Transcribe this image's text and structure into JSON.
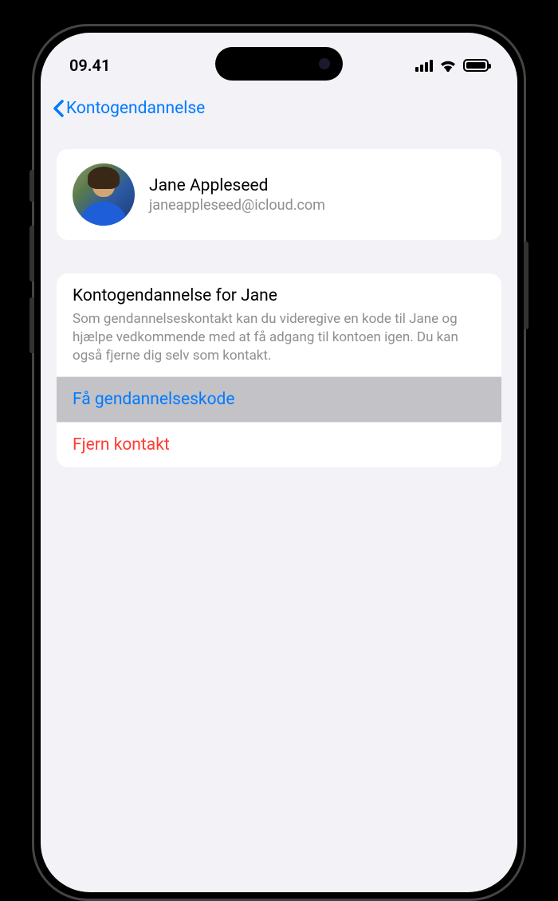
{
  "status": {
    "time": "09.41"
  },
  "nav": {
    "back_label": "Kontogendannelse"
  },
  "contact": {
    "name": "Jane Appleseed",
    "email": "janeappleseed@icloud.com"
  },
  "section": {
    "title": "Kontogendannelse for Jane",
    "description": "Som gendannelseskontakt kan du videregive en kode til Jane og hjælpe vedkommende med at få adgang til kontoen igen. Du kan også fjerne dig selv som kontakt."
  },
  "actions": {
    "get_code": "Få gendannelseskode",
    "remove": "Fjern kontakt"
  }
}
